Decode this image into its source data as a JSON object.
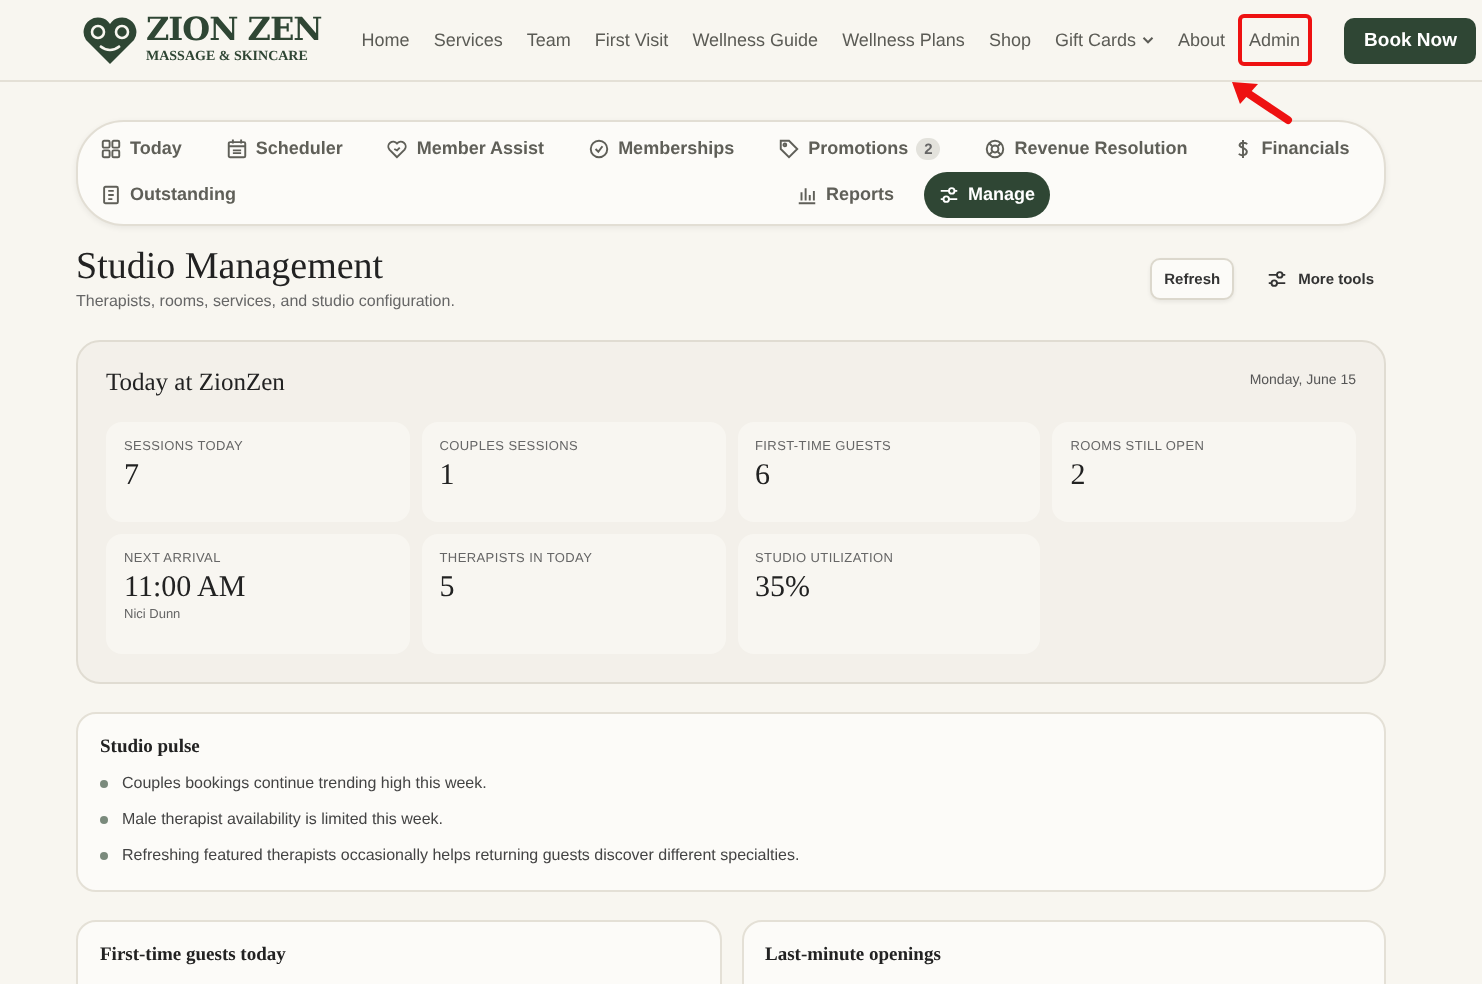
{
  "header": {
    "brand": {
      "name": "ZION ZEN",
      "tagline": "MASSAGE & SKINCARE"
    },
    "nav": [
      {
        "label": "Home",
        "dropdown": false,
        "highlighted": false
      },
      {
        "label": "Services",
        "dropdown": false,
        "highlighted": false
      },
      {
        "label": "Team",
        "dropdown": false,
        "highlighted": false
      },
      {
        "label": "First Visit",
        "dropdown": false,
        "highlighted": false
      },
      {
        "label": "Wellness Guide",
        "dropdown": false,
        "highlighted": false
      },
      {
        "label": "Wellness Plans",
        "dropdown": false,
        "highlighted": false
      },
      {
        "label": "Shop",
        "dropdown": false,
        "highlighted": false
      },
      {
        "label": "Gift Cards",
        "dropdown": true,
        "highlighted": false
      },
      {
        "label": "About",
        "dropdown": false,
        "highlighted": false
      },
      {
        "label": "Admin",
        "dropdown": false,
        "highlighted": true
      }
    ],
    "cta": "Book Now"
  },
  "tabs": [
    {
      "label": "Today",
      "selected": false
    },
    {
      "label": "Scheduler",
      "selected": false
    },
    {
      "label": "Member Assist",
      "selected": false
    },
    {
      "label": "Memberships",
      "selected": false
    },
    {
      "label": "Promotions",
      "selected": false,
      "badge": "2"
    },
    {
      "label": "Revenue Resolution",
      "selected": false
    },
    {
      "label": "Financials",
      "selected": false
    },
    {
      "label": "Outstanding",
      "selected": false
    },
    {
      "label": "Reports",
      "selected": false
    },
    {
      "label": "Manage",
      "selected": true
    }
  ],
  "page": {
    "title": "Studio Management",
    "subtitle": "Therapists, rooms, services, and studio configuration.",
    "actions": {
      "refresh": "Refresh",
      "more_tools": "More tools"
    }
  },
  "today": {
    "title": "Today at ZionZen",
    "date": "Monday, June 15",
    "stats": [
      {
        "label": "SESSIONS TODAY",
        "value": "7"
      },
      {
        "label": "COUPLES SESSIONS",
        "value": "1"
      },
      {
        "label": "FIRST-TIME GUESTS",
        "value": "6"
      },
      {
        "label": "ROOMS STILL OPEN",
        "value": "2"
      },
      {
        "label": "NEXT ARRIVAL",
        "value": "11:00 AM",
        "note": "Nici Dunn"
      },
      {
        "label": "THERAPISTS IN TODAY",
        "value": "5"
      },
      {
        "label": "STUDIO UTILIZATION",
        "value": "35%"
      }
    ]
  },
  "pulse": {
    "title": "Studio pulse",
    "items": [
      "Couples bookings continue trending high this week.",
      "Male therapist availability is limited this week.",
      "Refreshing featured therapists occasionally helps returning guests discover different specialties."
    ]
  },
  "panels": [
    {
      "title": "First-time guests today"
    },
    {
      "title": "Last-minute openings"
    }
  ]
}
